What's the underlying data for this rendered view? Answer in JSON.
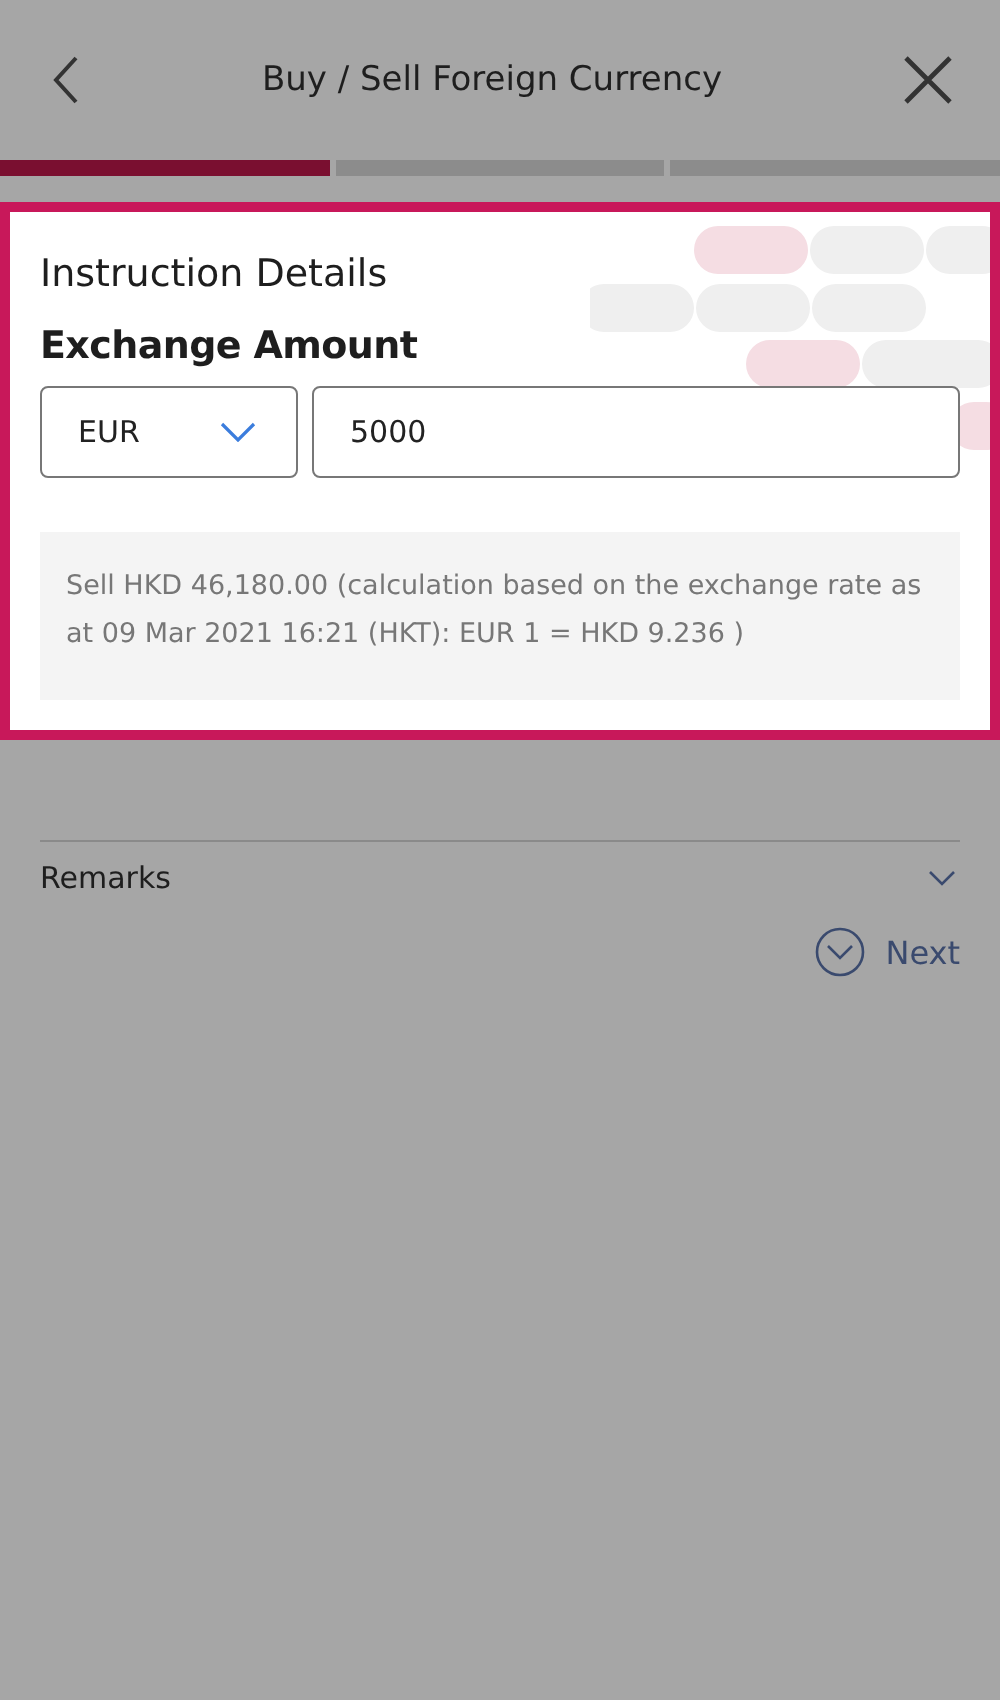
{
  "header": {
    "title": "Buy / Sell Foreign Currency"
  },
  "steps": [
    {
      "selected": true
    },
    {
      "selected": false
    },
    {
      "selected": false
    }
  ],
  "card": {
    "section_title": "Instruction Details",
    "heading": "Exchange Amount",
    "currency": {
      "value": "EUR"
    },
    "amount": {
      "value": "5000"
    },
    "note": "Sell HKD 46,180.00 (calculation based on the exchange rate as at 09 Mar 2021 16:21 (HKT): EUR 1 = HKD 9.236 )"
  },
  "remarks": {
    "label": "Remarks",
    "expanded": false
  },
  "next_button": {
    "label": "Next"
  }
}
